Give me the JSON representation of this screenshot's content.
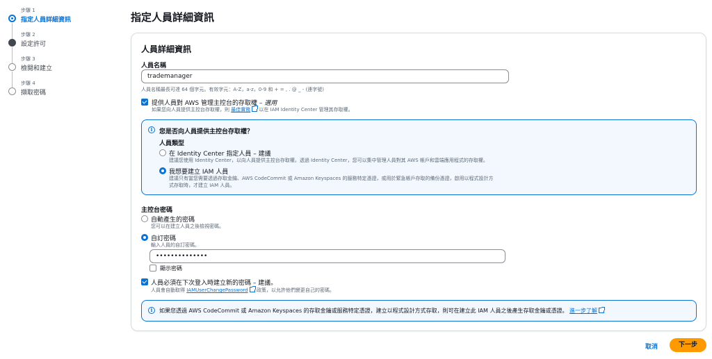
{
  "steps": [
    {
      "num": "步驟 1",
      "name": "指定人員詳細資訊",
      "state": "active"
    },
    {
      "num": "步驟 2",
      "name": "設定許可",
      "state": "done"
    },
    {
      "num": "步驟 3",
      "name": "檢閱和建立",
      "state": "todo"
    },
    {
      "num": "步驟 4",
      "name": "擷取密碼",
      "state": "todo"
    }
  ],
  "page_title": "指定人員詳細資訊",
  "card": {
    "title": "人員詳細資訊",
    "username": {
      "label": "人員名稱",
      "value": "trademanager",
      "hint": "人員名稱最長可達 64 個字元。有效字元：A-Z，a-z，0-9 和 + = , . @ _ - (連字號)"
    },
    "console_access": {
      "label_main": "提供人員對 AWS 管理主控台的存取權 – ",
      "label_em": "選用",
      "hint_pre": "如果您向人員提供主控台存取權，則 ",
      "hint_link": "最佳實務",
      "hint_post": " 以在 IAM Identity Center 管理其存取權。"
    },
    "info": {
      "question": "您是否向人員提供主控台存取權？",
      "user_type_label": "人員類型",
      "option1_label": "在 Identity Center 指定人員 – 建議",
      "option1_desc": "建議您使用 Identity Center，以向人員提供主控台存取權。透過 Identity Center，您可以集中管理人員對其 AWS 帳戶和雲端應用程式的存取權。",
      "option2_label": "我想要建立 IAM 人員",
      "option2_desc1": "建議只有當您需要透過存取金鑰、AWS CodeCommit 或 Amazon Keyspaces 的服務特定憑證，或用於緊急帳戶存取的備份憑證，啟用以程式設計方",
      "option2_desc2": "式存取時，才建立 IAM 人員。"
    },
    "password": {
      "label": "主控台密碼",
      "auto_label": "自動產生的密碼",
      "auto_desc": "您可以在建立人員之後檢視密碼。",
      "custom_label": "自訂密碼",
      "custom_desc": "輸入人員的自訂密碼。",
      "value": "••••••••••••••",
      "show_label": "顯示密碼"
    },
    "reset": {
      "label": "人員必須在下次登入時建立新的密碼 – 建議。",
      "desc_pre": "人員會自動取得 ",
      "desc_link": "IAMUserChangePassword",
      "desc_post": " 政策，以允許他們變更自己的密碼。"
    },
    "bottom_info": {
      "text": "如果您透過 AWS CodeCommit 或 Amazon Keyspaces 的存取金鑰或服務特定憑證，建立以程式設計方式存取，則可在建立此 IAM 人員之後產生存取金鑰或憑證。",
      "link": "進一步了解"
    }
  },
  "footer": {
    "cancel": "取消",
    "next": "下一步"
  },
  "colors": {
    "accent": "#0972d3",
    "primary_button": "#ff9900",
    "info_bg": "#f2f8fd"
  }
}
